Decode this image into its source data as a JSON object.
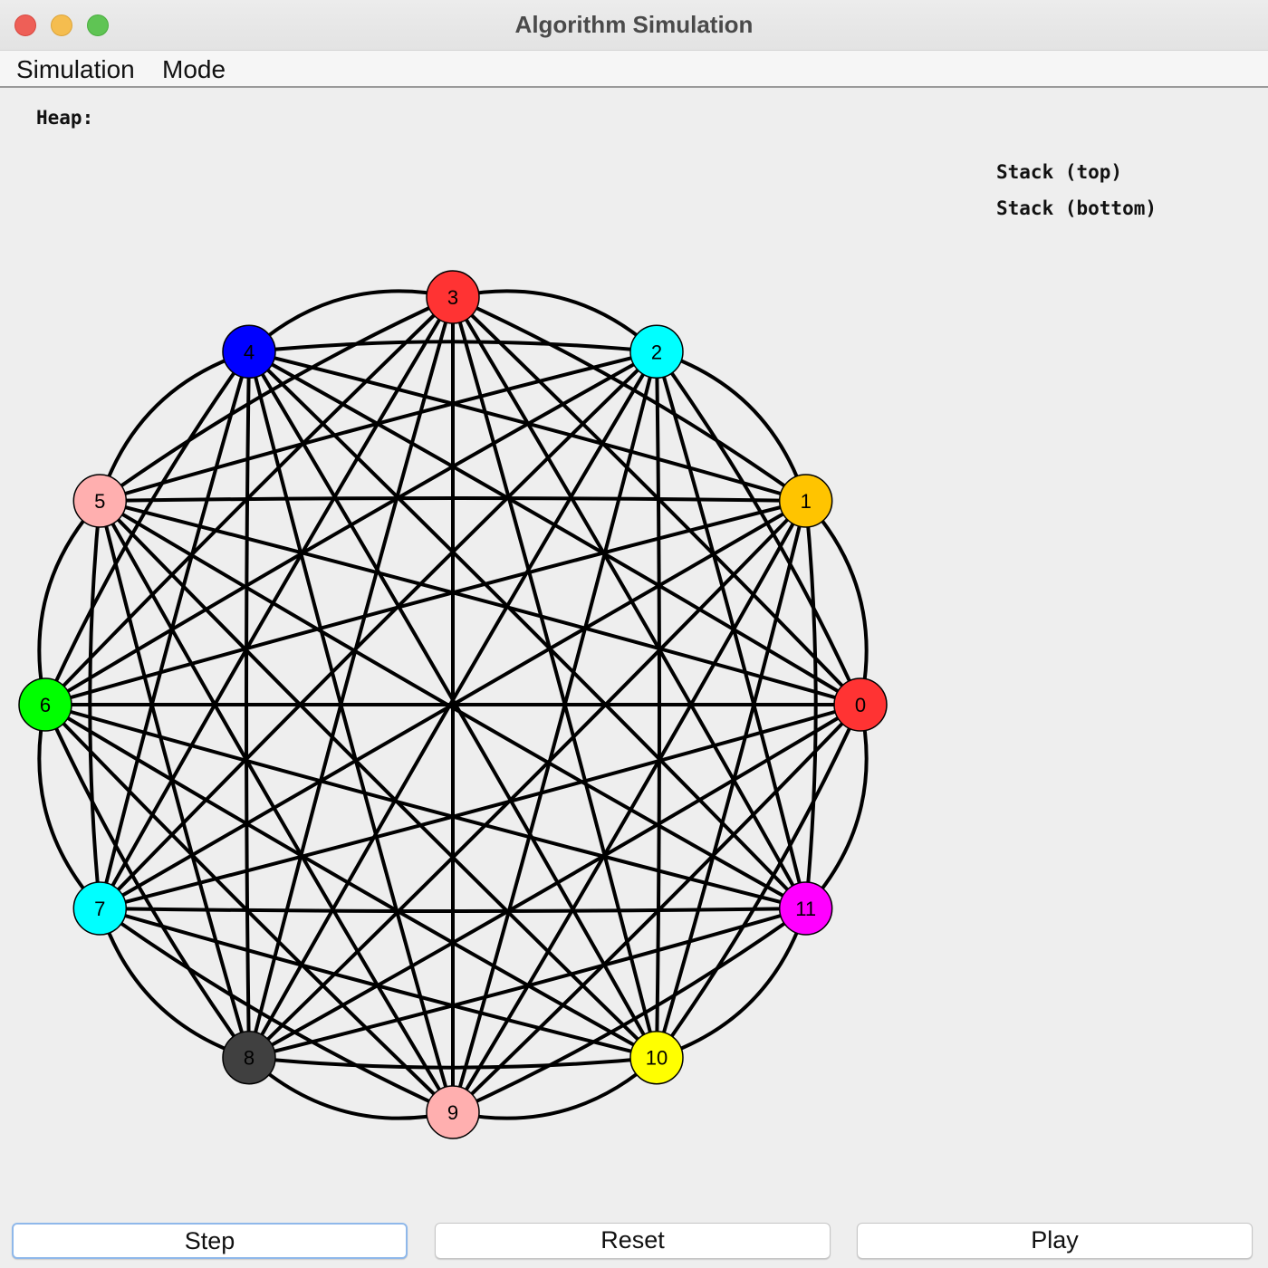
{
  "window": {
    "title": "Algorithm Simulation"
  },
  "menu": {
    "items": [
      "Simulation",
      "Mode"
    ]
  },
  "panel": {
    "heap_label": "Heap:",
    "stack_top_label": "Stack (top)",
    "stack_bottom_label": "Stack (bottom)"
  },
  "graph": {
    "edge_color": "#000000",
    "nodes": [
      {
        "id": "0",
        "color": "#ff3333"
      },
      {
        "id": "1",
        "color": "#ffc400"
      },
      {
        "id": "2",
        "color": "#00ffff"
      },
      {
        "id": "3",
        "color": "#ff3333"
      },
      {
        "id": "4",
        "color": "#0000ff"
      },
      {
        "id": "5",
        "color": "#ffafaf"
      },
      {
        "id": "6",
        "color": "#00ff00"
      },
      {
        "id": "7",
        "color": "#00ffff"
      },
      {
        "id": "8",
        "color": "#404040"
      },
      {
        "id": "9",
        "color": "#ffafaf"
      },
      {
        "id": "10",
        "color": "#ffff00"
      },
      {
        "id": "11",
        "color": "#ff00ff"
      }
    ],
    "edges": "complete"
  },
  "buttons": {
    "step": "Step",
    "reset": "Reset",
    "play": "Play"
  }
}
